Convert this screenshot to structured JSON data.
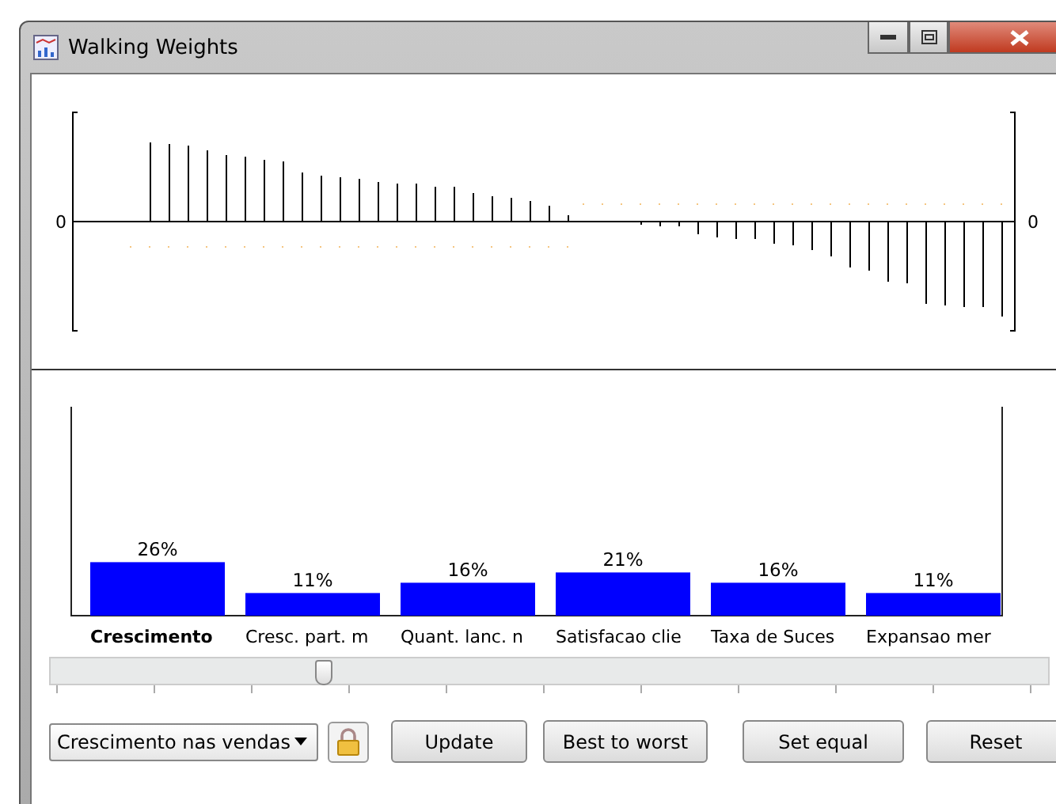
{
  "window": {
    "title": "Walking Weights"
  },
  "weights_plot": {
    "left_axis_label": "0",
    "right_axis_label": "0"
  },
  "bar_chart": {
    "chart_data": {
      "type": "bar",
      "categories": [
        "Crescimento",
        "Cresc. part. m",
        "Quant. lanc. n",
        "Satisfacao clie",
        "Taxa de Suces",
        "Expansao mer"
      ],
      "values": [
        26,
        11,
        16,
        21,
        16,
        11
      ],
      "data_labels": true,
      "value_labels": [
        "26%",
        "11%",
        "16%",
        "21%",
        "16%",
        "11%"
      ]
    },
    "selected": [
      true,
      false,
      false,
      false,
      false,
      false
    ]
  },
  "slider": {
    "level": 0.27
  },
  "criterion_dropdown": {
    "value": "Crescimento nas vendas"
  },
  "lock": {
    "locked": true
  },
  "buttons": [
    "Update",
    "Best to worst",
    "Set equal",
    "Reset"
  ]
}
